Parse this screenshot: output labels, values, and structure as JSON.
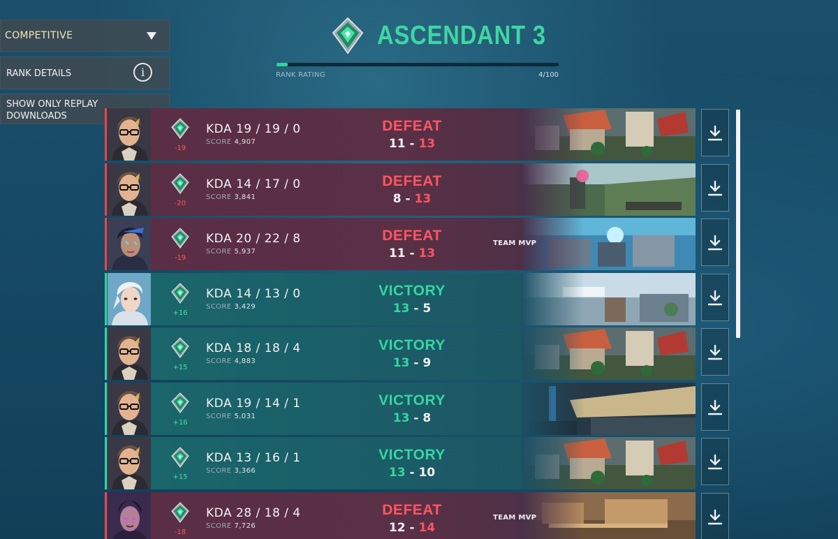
{
  "sidebar": {
    "mode": "COMPETITIVE",
    "rank_details": "RANK DETAILS",
    "info_glyph": "i",
    "replay_filter": "SHOW ONLY REPLAY DOWNLOADS"
  },
  "header": {
    "rank": "ASCENDANT 3",
    "rank_rating_label": "RANK RATING",
    "rank_rating_value": "4/100",
    "rank_rating_progress": 0.04
  },
  "colors": {
    "accent_green": "#35d6a1",
    "defeat_red": "#ff5560",
    "defeat_row": "#5a2d43",
    "victory_row": "#19686c"
  },
  "icons": [
    "chevron-down-icon",
    "info-icon",
    "rank-emblem-icon",
    "download-icon"
  ],
  "matches": [
    {
      "outcome": "defeat",
      "agent": "chamber",
      "rr": "-19",
      "kda": "KDA 19 / 19 / 0",
      "score_label": "SCORE",
      "score": "4,907",
      "result": "DEFEAT",
      "ours": "11",
      "dash": "-",
      "theirs": "13",
      "mvp": "",
      "map": "split"
    },
    {
      "outcome": "defeat",
      "agent": "chamber",
      "rr": "-20",
      "kda": "KDA 14 / 17 / 0",
      "score_label": "SCORE",
      "score": "3,841",
      "result": "DEFEAT",
      "ours": "8",
      "dash": "-",
      "theirs": "13",
      "mvp": "",
      "map": "lotus"
    },
    {
      "outcome": "defeat",
      "agent": "neon",
      "rr": "-19",
      "kda": "KDA 20 / 22 / 8",
      "score_label": "SCORE",
      "score": "5,937",
      "result": "DEFEAT",
      "ours": "11",
      "dash": "-",
      "theirs": "13",
      "mvp": "TEAM MVP",
      "map": "pearl"
    },
    {
      "outcome": "victory",
      "agent": "jett",
      "rr": "+16",
      "kda": "KDA 14 / 13 / 0",
      "score_label": "SCORE",
      "score": "3,429",
      "result": "VICTORY",
      "ours": "13",
      "dash": "-",
      "theirs": "5",
      "mvp": "",
      "map": "icebox"
    },
    {
      "outcome": "victory",
      "agent": "chamber",
      "rr": "+15",
      "kda": "KDA 18 / 18 / 4",
      "score_label": "SCORE",
      "score": "4,883",
      "result": "VICTORY",
      "ours": "13",
      "dash": "-",
      "theirs": "9",
      "mvp": "",
      "map": "split"
    },
    {
      "outcome": "victory",
      "agent": "chamber",
      "rr": "+16",
      "kda": "KDA 19 / 14 / 1",
      "score_label": "SCORE",
      "score": "5,031",
      "result": "VICTORY",
      "ours": "13",
      "dash": "-",
      "theirs": "8",
      "mvp": "",
      "map": "haven"
    },
    {
      "outcome": "victory",
      "agent": "chamber",
      "rr": "+15",
      "kda": "KDA 13 / 16 / 1",
      "score_label": "SCORE",
      "score": "3,366",
      "result": "VICTORY",
      "ours": "13",
      "dash": "-",
      "theirs": "10",
      "mvp": "",
      "map": "split"
    },
    {
      "outcome": "defeat",
      "agent": "reyna",
      "rr": "-18",
      "kda": "KDA 28 / 18 / 4",
      "score_label": "SCORE",
      "score": "7,726",
      "result": "DEFEAT",
      "ours": "12",
      "dash": "-",
      "theirs": "14",
      "mvp": "TEAM MVP",
      "map": "bind"
    }
  ]
}
